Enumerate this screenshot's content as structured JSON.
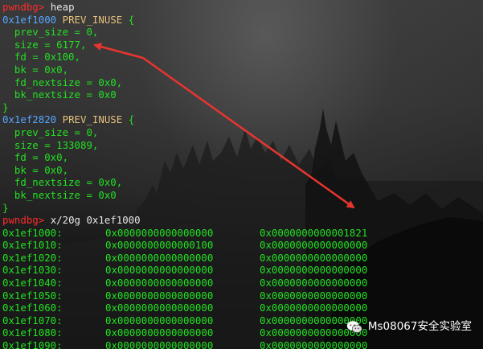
{
  "terminal": {
    "prompt": "pwndbg>",
    "command_1": "heap",
    "chunks": [
      {
        "address": "0x1ef1000",
        "flag": "PREV_INUSE",
        "fields": [
          "prev_size = 0,",
          "size = 6177,",
          "fd = 0x100,",
          "bk = 0x0,",
          "fd_nextsize = 0x0,",
          "bk_nextsize = 0x0"
        ]
      },
      {
        "address": "0x1ef2820",
        "flag": "PREV_INUSE",
        "fields": [
          "prev_size = 0,",
          "size = 133089,",
          "fd = 0x0,",
          "bk = 0x0,",
          "fd_nextsize = 0x0,",
          "bk_nextsize = 0x0"
        ]
      }
    ],
    "open_brace": "{",
    "close_brace": "}",
    "command_2": "x/20g 0x1ef1000",
    "memory_rows": [
      [
        "0x1ef1000:",
        "0x0000000000000000",
        "0x0000000000001821"
      ],
      [
        "0x1ef1010:",
        "0x0000000000000100",
        "0x0000000000000000"
      ],
      [
        "0x1ef1020:",
        "0x0000000000000000",
        "0x0000000000000000"
      ],
      [
        "0x1ef1030:",
        "0x0000000000000000",
        "0x0000000000000000"
      ],
      [
        "0x1ef1040:",
        "0x0000000000000000",
        "0x0000000000000000"
      ],
      [
        "0x1ef1050:",
        "0x0000000000000000",
        "0x0000000000000000"
      ],
      [
        "0x1ef1060:",
        "0x0000000000000000",
        "0x0000000000000000"
      ],
      [
        "0x1ef1070:",
        "0x0000000000000000",
        "0x0000000000000000"
      ],
      [
        "0x1ef1080:",
        "0x0000000000000000",
        "0x0000000000000000"
      ],
      [
        "0x1ef1090:",
        "0x0000000000000000",
        "0x0000000000000000"
      ]
    ]
  },
  "watermark": {
    "text": "Ms08067安全实验室",
    "icon": "wechat-icon"
  },
  "colors": {
    "prompt": "#ff2b2b",
    "address": "#58a6ff",
    "flag": "#e5c07b",
    "output": "#22e022",
    "arrow": "#e8352f"
  }
}
